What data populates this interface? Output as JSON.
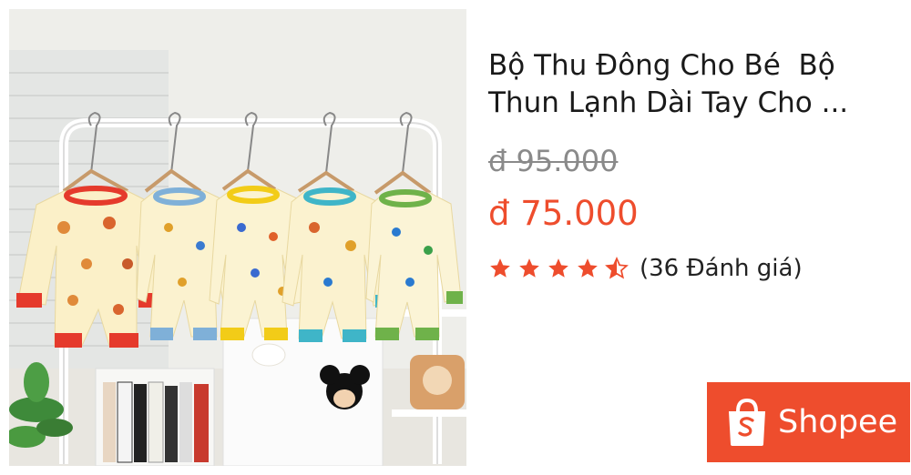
{
  "product": {
    "title": "Bộ Thu Đông Cho Bé  Bộ Thun Lạnh Dài Tay Cho ...",
    "old_price": "đ 95.000",
    "new_price": "đ 75.000",
    "rating": 4.5,
    "reviews": "(36 Đánh giá)"
  },
  "brand": {
    "name": "Shopee",
    "color": "#ee4d2d"
  },
  "icons": [
    "star-icon",
    "half-star-icon",
    "shopee-bag-icon"
  ]
}
